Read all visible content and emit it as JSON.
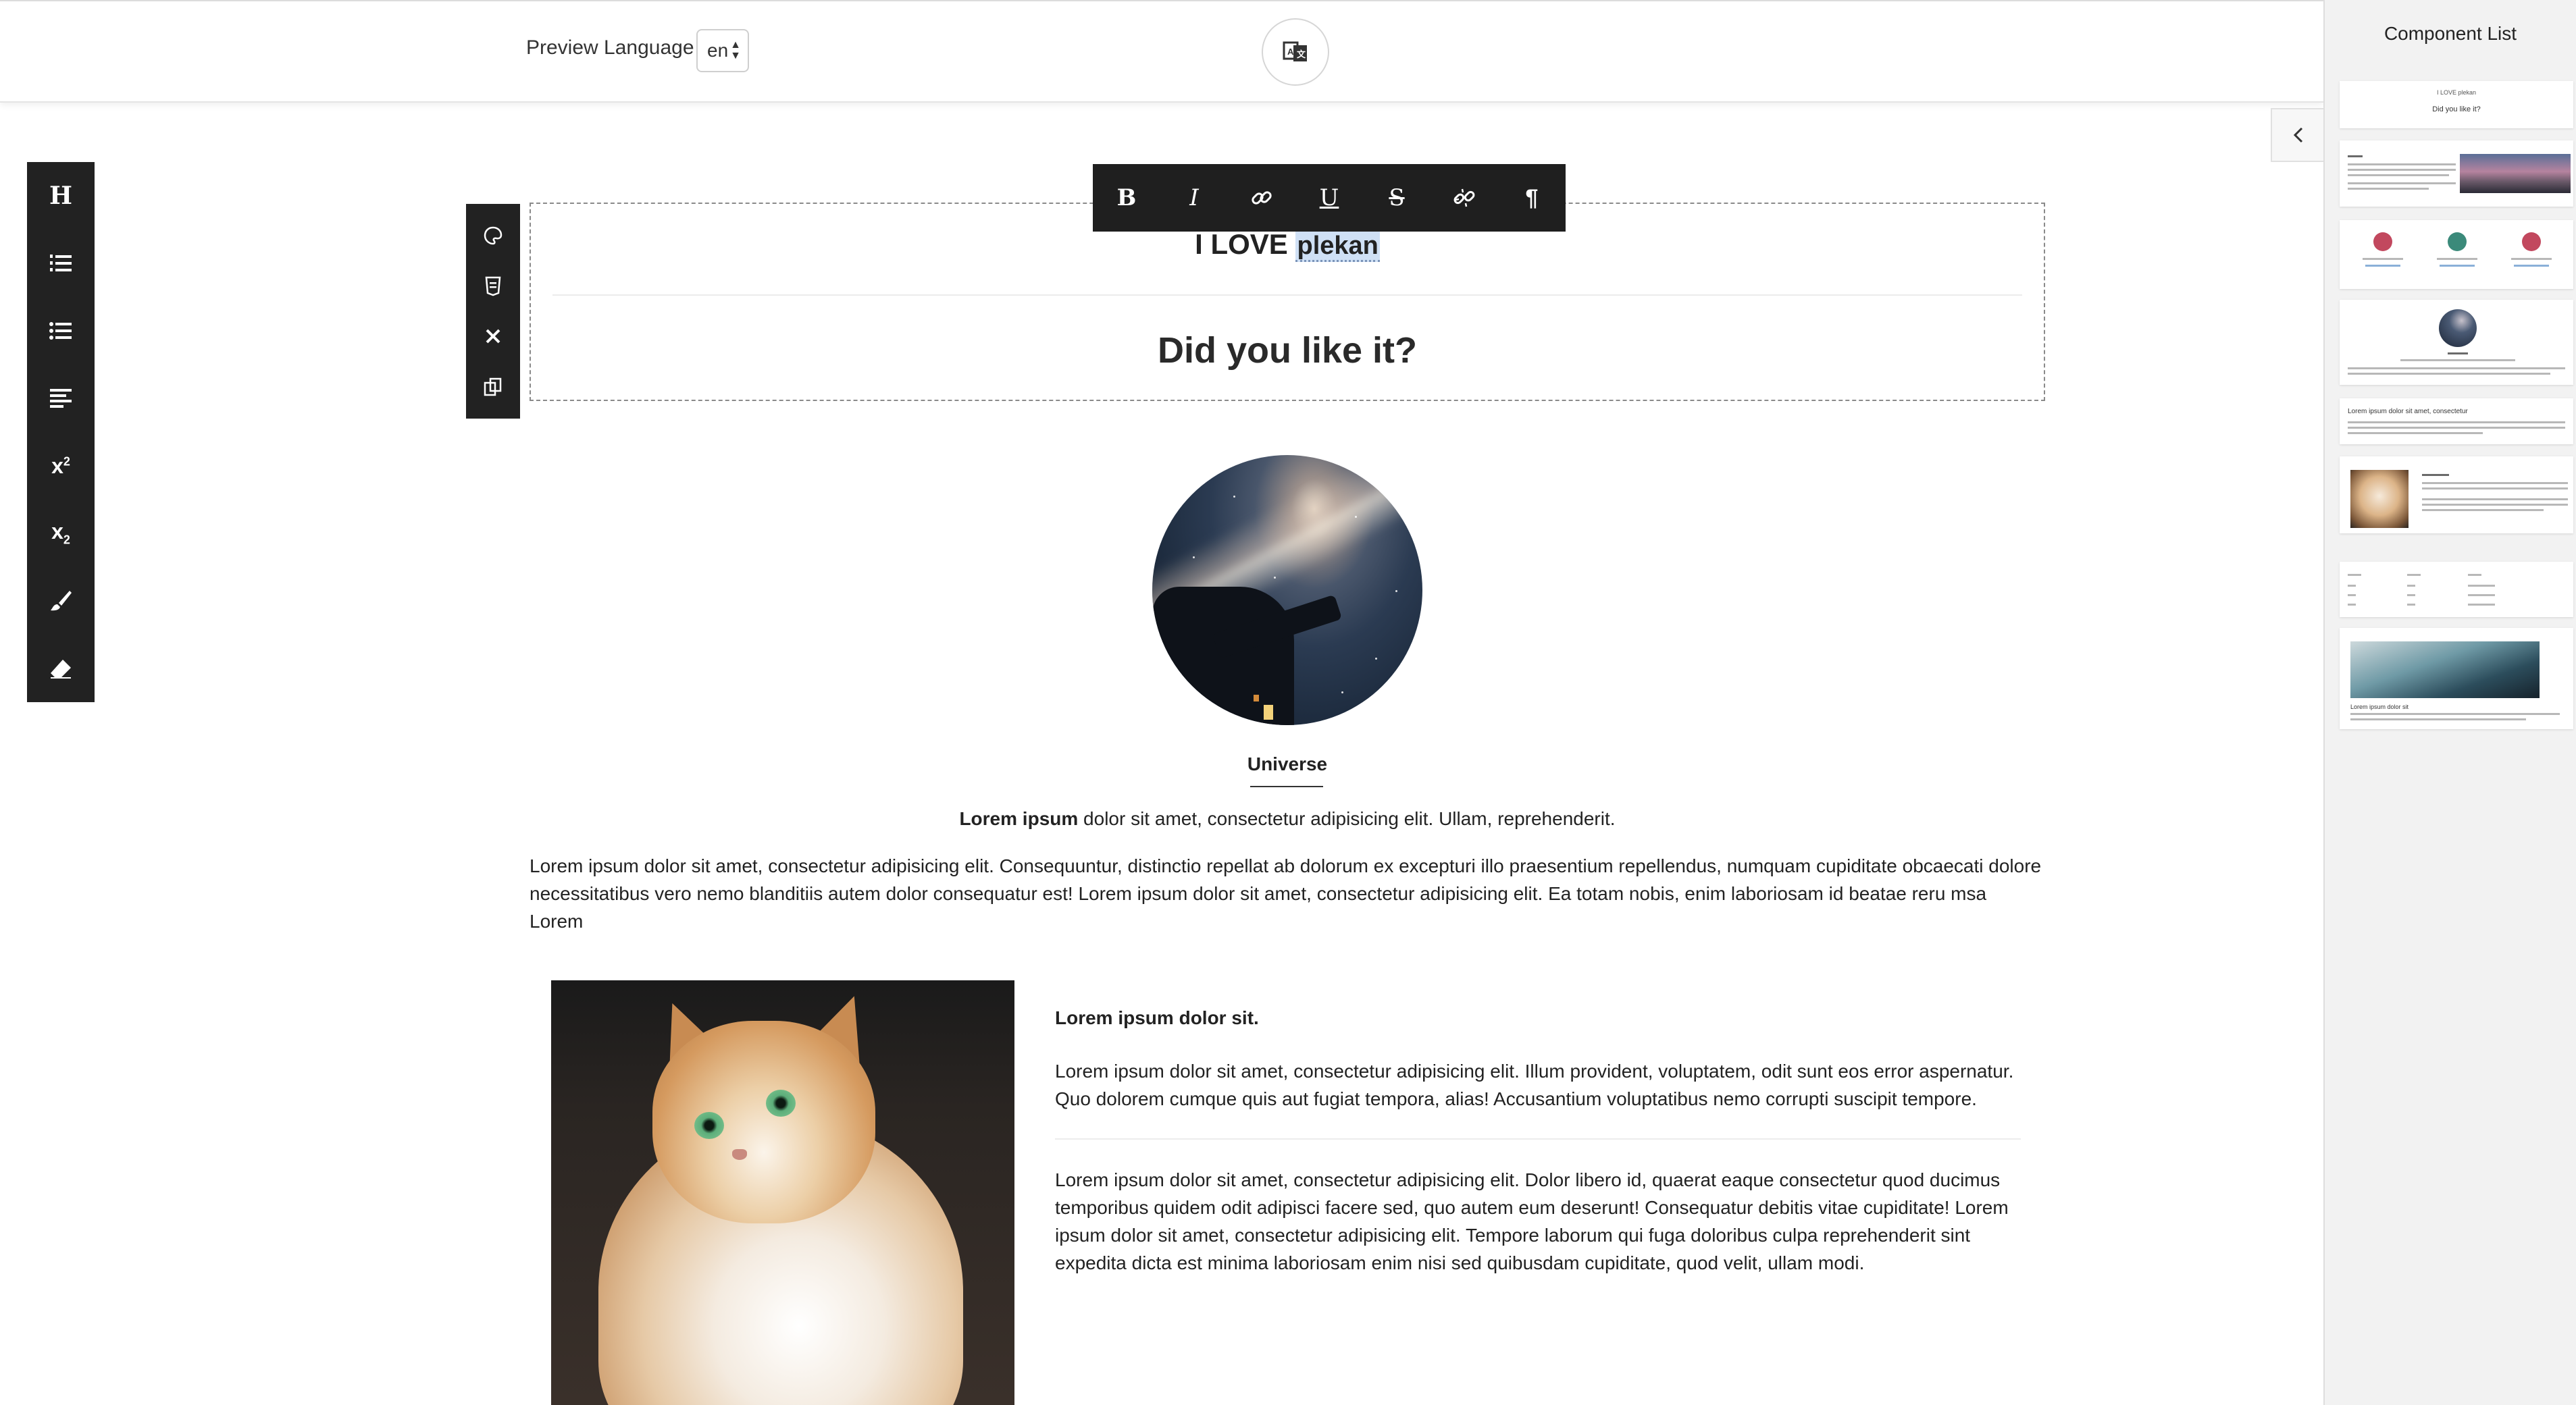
{
  "topbar": {
    "preview_language_label": "Preview Language",
    "language_value": "en",
    "language_arrows": "▲▼"
  },
  "left_toolbar": {
    "tools": [
      "heading",
      "ordered-list",
      "unordered-list",
      "align",
      "superscript",
      "subscript",
      "brush",
      "eraser"
    ],
    "heading_glyph": "H",
    "superscript_glyph": "x",
    "superscript_mark": "2",
    "subscript_glyph": "x",
    "subscript_mark": "2"
  },
  "format_toolbar": {
    "bold": "B",
    "italic": "I",
    "underline": "U",
    "strikethrough": "S",
    "paragraph": "¶"
  },
  "block1": {
    "heading_prefix": "I LOVE",
    "heading_selected": "plekan",
    "subheading": "Did you like it?"
  },
  "block2": {
    "caption": "Universe",
    "lead_bold": "Lorem ipsum",
    "lead_rest": " dolor sit amet, consectetur adipisicing elit. Ullam, reprehenderit.",
    "paragraph": "Lorem ipsum dolor sit amet, consectetur adipisicing elit. Consequuntur, distinctio repellat ab dolorum ex excepturi illo praesentium repellendus, numquam cupiditate obcaecati dolore necessitatibus vero nemo blanditiis autem dolor consequatur est! Lorem ipsum dolor sit amet, consectetur adipisicing elit. Ea totam nobis, enim laboriosam id beatae reru msa Lorem"
  },
  "block3": {
    "title": "Lorem ipsum dolor sit.",
    "paragraph1": "Lorem ipsum dolor sit amet, consectetur adipisicing elit. Illum provident, voluptatem, odit sunt eos error aspernatur. Quo dolorem cumque quis aut fugiat tempora, alias! Accusantium voluptatibus nemo corrupti suscipit tempore.",
    "paragraph2": "Lorem ipsum dolor sit amet, consectetur adipisicing elit. Dolor libero id, quaerat eaque consectetur quod ducimus temporibus quidem odit adipisci facere sed, quo autem eum deserunt! Consequatur debitis vitae cupiditate! Lorem ipsum dolor sit amet, consectetur adipisicing elit. Tempore laborum qui fuga doloribus culpa reprehenderit sint expedita dicta est minima laboriosam enim nisi sed quibusdam cupiditate, quod velit, ullam modi."
  },
  "component_panel": {
    "title": "Component List",
    "collapse_arrow": "‹",
    "thumb1_small": "I LOVE plekan",
    "thumb1_title": "Did you like it?",
    "thumb5_title": "Lorem ipsum dolor sit amet, consectetur",
    "thumb8_title": "Lorem ipsum dolor sit"
  },
  "colors": {
    "toolbar_bg": "#222222",
    "selection_highlight": "#cfe0f5",
    "panel_bg": "#f2f2f2"
  }
}
